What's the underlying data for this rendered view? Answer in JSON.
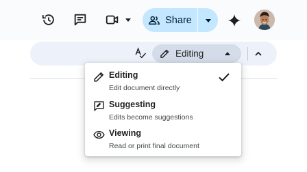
{
  "header": {
    "icons": {
      "history": "history-icon",
      "comments": "comments-icon",
      "meet": "video-call-icon",
      "gemini": "gemini-sparkle-icon"
    },
    "share": {
      "label": "Share",
      "icon": "people-icon",
      "dropdown_icon": "caret-down-icon"
    },
    "avatar": "user-avatar"
  },
  "toolbar": {
    "spellcheck_icon": "spellcheck-icon",
    "mode": {
      "label": "Editing",
      "icon": "pencil-icon",
      "caret": "caret-up-icon"
    },
    "collapse_icon": "chevron-up-icon"
  },
  "mode_menu": {
    "items": [
      {
        "title": "Editing",
        "description": "Edit document directly",
        "icon": "pencil-icon",
        "selected": true
      },
      {
        "title": "Suggesting",
        "description": "Edits become suggestions",
        "icon": "suggest-edit-icon",
        "selected": false
      },
      {
        "title": "Viewing",
        "description": "Read or print final document",
        "icon": "eye-icon",
        "selected": false
      }
    ]
  },
  "colors": {
    "header_bg": "#f9fbfd",
    "share_bg": "#c2e7ff",
    "toolbar_bg": "#edf2fa",
    "mode_pill_bg": "#d3dce8",
    "text": "#1f1f1f"
  }
}
